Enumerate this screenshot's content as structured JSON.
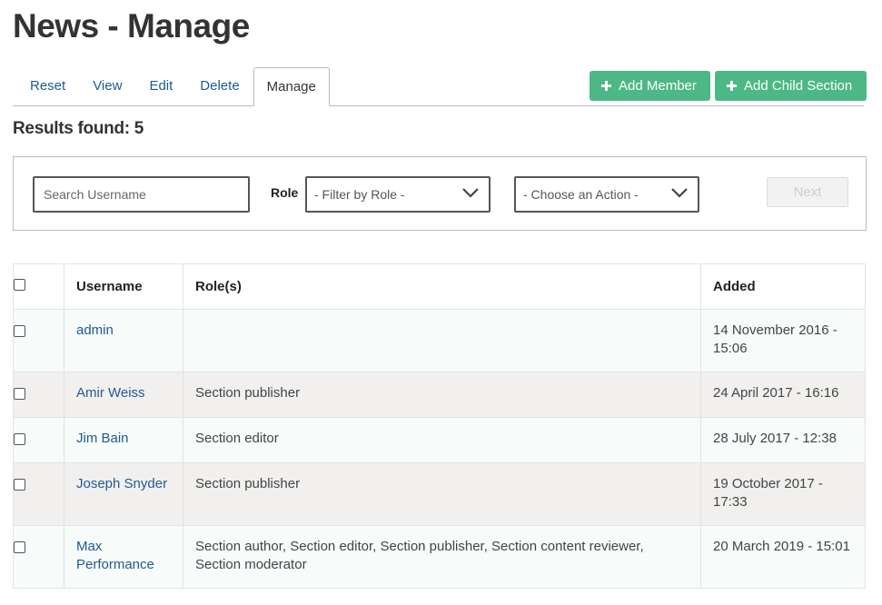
{
  "page": {
    "title": "News - Manage"
  },
  "tabs": [
    {
      "label": "Reset"
    },
    {
      "label": "View"
    },
    {
      "label": "Edit"
    },
    {
      "label": "Delete"
    },
    {
      "label": "Manage",
      "active": true
    }
  ],
  "actions": {
    "add_member": "Add Member",
    "add_child_section": "Add Child Section",
    "accent_color": "#4cb885"
  },
  "results": {
    "label": "Results found: 5"
  },
  "filters": {
    "search_placeholder": "Search Username",
    "role_label": "Role",
    "role_select": "- Filter by Role -",
    "action_select": "- Choose an Action -",
    "next_label": "Next"
  },
  "table": {
    "columns": [
      "Username",
      "Role(s)",
      "Added"
    ],
    "rows": [
      {
        "username": "admin",
        "roles": "",
        "added": "14 November 2016 - 15:06"
      },
      {
        "username": "Amir Weiss",
        "roles": "Section publisher",
        "added": "24 April 2017 - 16:16"
      },
      {
        "username": "Jim Bain",
        "roles": "Section editor",
        "added": "28 July 2017 - 12:38"
      },
      {
        "username": "Joseph Snyder",
        "roles": "Section publisher",
        "added": "19 October 2017 - 17:33"
      },
      {
        "username": "Max Performance",
        "roles": "Section author, Section editor, Section publisher, Section content reviewer, Section moderator",
        "added": "20 March 2019 - 15:01"
      }
    ]
  }
}
